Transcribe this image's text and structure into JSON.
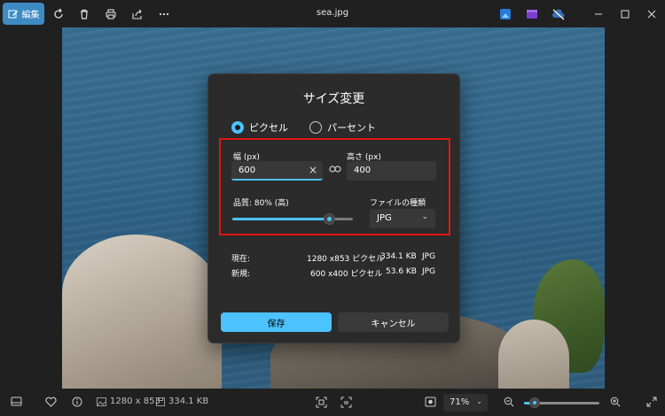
{
  "toolbar": {
    "edit_label": "編集",
    "file_name": "sea.jpg",
    "icons": [
      "edit-icon",
      "rotate-icon",
      "delete-icon",
      "print-icon",
      "share-icon",
      "more-icon"
    ]
  },
  "window_controls": {
    "icons": [
      "minimize-icon",
      "maximize-icon",
      "close-icon"
    ],
    "cloud_icons": [
      "photo-app-icon",
      "clipchamp-icon",
      "cloud-off-icon"
    ]
  },
  "dialog": {
    "title": "サイズ変更",
    "radio_pixel": "ピクセル",
    "radio_percent": "パーセント",
    "selected": "ピクセル",
    "width_label": "幅 (px)",
    "width_value": "600",
    "height_label": "高さ (px)",
    "height_value": "400",
    "quality_label": "品質: 80% (高)",
    "quality_value": 80,
    "filetype_label": "ファイルの種類",
    "filetype_value": "JPG",
    "current": {
      "label": "現在:",
      "dims": "1280 x853 ピクセル",
      "size": "334.1 KB",
      "type": "JPG"
    },
    "new": {
      "label": "新規:",
      "dims": "600 x400 ピクセル",
      "size": "53.6 KB",
      "type": "JPG"
    },
    "save_label": "保存",
    "cancel_label": "キャンセル"
  },
  "statusbar": {
    "dimensions": "1280 x 853",
    "filesize": "334.1 KB",
    "zoom": "71%",
    "zoom_fraction": 0.14
  },
  "colors": {
    "accent": "#4cc2ff",
    "edit_button": "#3e8bc4",
    "highlight_box": "#e31515"
  }
}
